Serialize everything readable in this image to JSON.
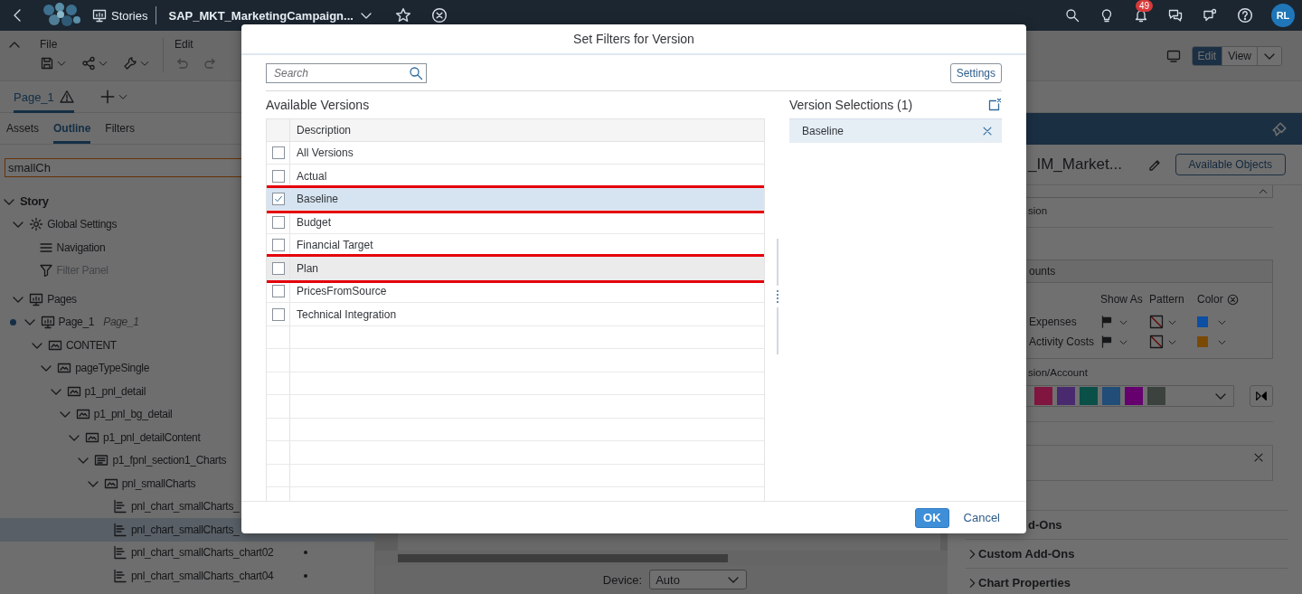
{
  "shell_bar": {
    "app_label": "Stories",
    "story_title": "SAP_MKT_MarketingCampaign...",
    "notification_count": "49",
    "avatar_initials": "RL"
  },
  "toolbar": {
    "groups": [
      {
        "label": "File"
      },
      {
        "label": "Edit"
      }
    ],
    "modes": [
      {
        "label": "Edit",
        "selected": true
      },
      {
        "label": "View",
        "selected": false
      }
    ]
  },
  "page_tabs": [
    {
      "label": "Page_1",
      "selected": true,
      "warning": true
    }
  ],
  "left_panel": {
    "tabs": [
      {
        "label": "Assets",
        "selected": false
      },
      {
        "label": "Outline",
        "selected": true
      },
      {
        "label": "Filters",
        "selected": false
      }
    ],
    "search": {
      "value": "smallCh"
    },
    "tree": [
      {
        "label": "Story",
        "kind": "root",
        "expanded": true,
        "selected": false,
        "children": [
          {
            "label": "Global Settings",
            "kind": "settings",
            "expanded": true,
            "selected": false,
            "children": [
              {
                "label": "Navigation",
                "kind": "navigation",
                "selected": false,
                "disabled": false
              },
              {
                "label": "Filter Panel",
                "kind": "filter",
                "selected": false,
                "disabled": true
              }
            ]
          },
          {
            "label": "Pages",
            "kind": "pages",
            "expanded": true,
            "selected": false,
            "children": [
              {
                "label": "Page_1",
                "subtitle": "Page_1",
                "kind": "page",
                "leading_dot": true,
                "expanded": true,
                "selected": false,
                "children": [
                  {
                    "label": "CONTENT",
                    "kind": "panel",
                    "expanded": true,
                    "selected": false,
                    "children": [
                      {
                        "label": "pageTypeSingle",
                        "kind": "panel",
                        "expanded": true,
                        "selected": false,
                        "children": [
                          {
                            "label": "p1_pnl_detail",
                            "kind": "panel",
                            "expanded": true,
                            "selected": false,
                            "children": [
                              {
                                "label": "p1_pnl_bg_detail",
                                "kind": "panel",
                                "expanded": true,
                                "selected": false,
                                "children": [
                                  {
                                    "label": "p1_pnl_detailContent",
                                    "kind": "panel",
                                    "expanded": true,
                                    "selected": false,
                                    "children": [
                                      {
                                        "label": "p1_fpnl_section1_Charts",
                                        "kind": "section",
                                        "expanded": true,
                                        "selected": false,
                                        "children": [
                                          {
                                            "label": "pnl_smallCharts",
                                            "kind": "panel",
                                            "expanded": true,
                                            "selected": false,
                                            "children": [
                                              {
                                                "label": "pnl_chart_smallCharts_",
                                                "kind": "chart",
                                                "selected": false
                                              },
                                              {
                                                "label": "pnl_chart_smallCharts_",
                                                "kind": "chart",
                                                "selected": true
                                              },
                                              {
                                                "label": "pnl_chart_smallCharts_chart02",
                                                "kind": "chart",
                                                "trailing_dot": true,
                                                "selected": false
                                              },
                                              {
                                                "label": "pnl_chart_smallCharts_chart04",
                                                "kind": "chart",
                                                "trailing_dot": true,
                                                "selected": false
                                              }
                                            ]
                                          }
                                        ]
                                      }
                                    ]
                                  }
                                ]
                              }
                            ]
                          }
                        ]
                      }
                    ]
                  }
                ]
              }
            ]
          }
        ]
      }
    ]
  },
  "canvas": {
    "device_label": "Device:",
    "device_value": "Auto"
  },
  "builder_panel": {
    "model_name": "_IM_Market...",
    "available_objects_button": "Available Objects",
    "dimension_text": "sion",
    "accounts_header": "ounts",
    "columns": [
      "Show As",
      "Pattern",
      "Color"
    ],
    "accounts": [
      {
        "label": "Expenses",
        "color": "#0c4fa3"
      },
      {
        "label": "Activity Costs",
        "color": "#7a4a05"
      }
    ],
    "palette_label": "sion/Account",
    "palette": [
      {
        "color": "#80163f"
      },
      {
        "color": "#4a2a6e"
      },
      {
        "color": "#0a4f48"
      },
      {
        "color": "#224d78"
      },
      {
        "color": "#65006e"
      },
      {
        "color": "#3c423d"
      }
    ],
    "partial_section": "d-Ons",
    "sections": [
      {
        "label": "Custom Add-Ons",
        "expanded": false
      },
      {
        "label": "Chart Properties",
        "expanded": false
      }
    ]
  },
  "dialog": {
    "title": "Set Filters for Version",
    "search_placeholder": "Search",
    "settings_button": "Settings",
    "available_title": "Available Versions",
    "column_header": "Description",
    "versions": [
      {
        "label": "All Versions",
        "checked": false,
        "selected": false,
        "hovered": false,
        "highlighted": false
      },
      {
        "label": "Actual",
        "checked": false,
        "selected": false,
        "hovered": false,
        "highlighted": false
      },
      {
        "label": "Baseline",
        "checked": true,
        "selected": true,
        "hovered": false,
        "highlighted": true
      },
      {
        "label": "Budget",
        "checked": false,
        "selected": false,
        "hovered": false,
        "highlighted": false
      },
      {
        "label": "Financial Target",
        "checked": false,
        "selected": false,
        "hovered": false,
        "highlighted": false
      },
      {
        "label": "Plan",
        "checked": false,
        "selected": false,
        "hovered": true,
        "highlighted": true
      },
      {
        "label": "PricesFromSource",
        "checked": false,
        "selected": false,
        "hovered": false,
        "highlighted": false
      },
      {
        "label": "Technical Integration",
        "checked": false,
        "selected": false,
        "hovered": false,
        "highlighted": false
      }
    ],
    "selection_title": "Version Selections (1)",
    "selections": [
      {
        "label": "Baseline"
      }
    ],
    "ok_button": "OK",
    "cancel_button": "Cancel"
  }
}
